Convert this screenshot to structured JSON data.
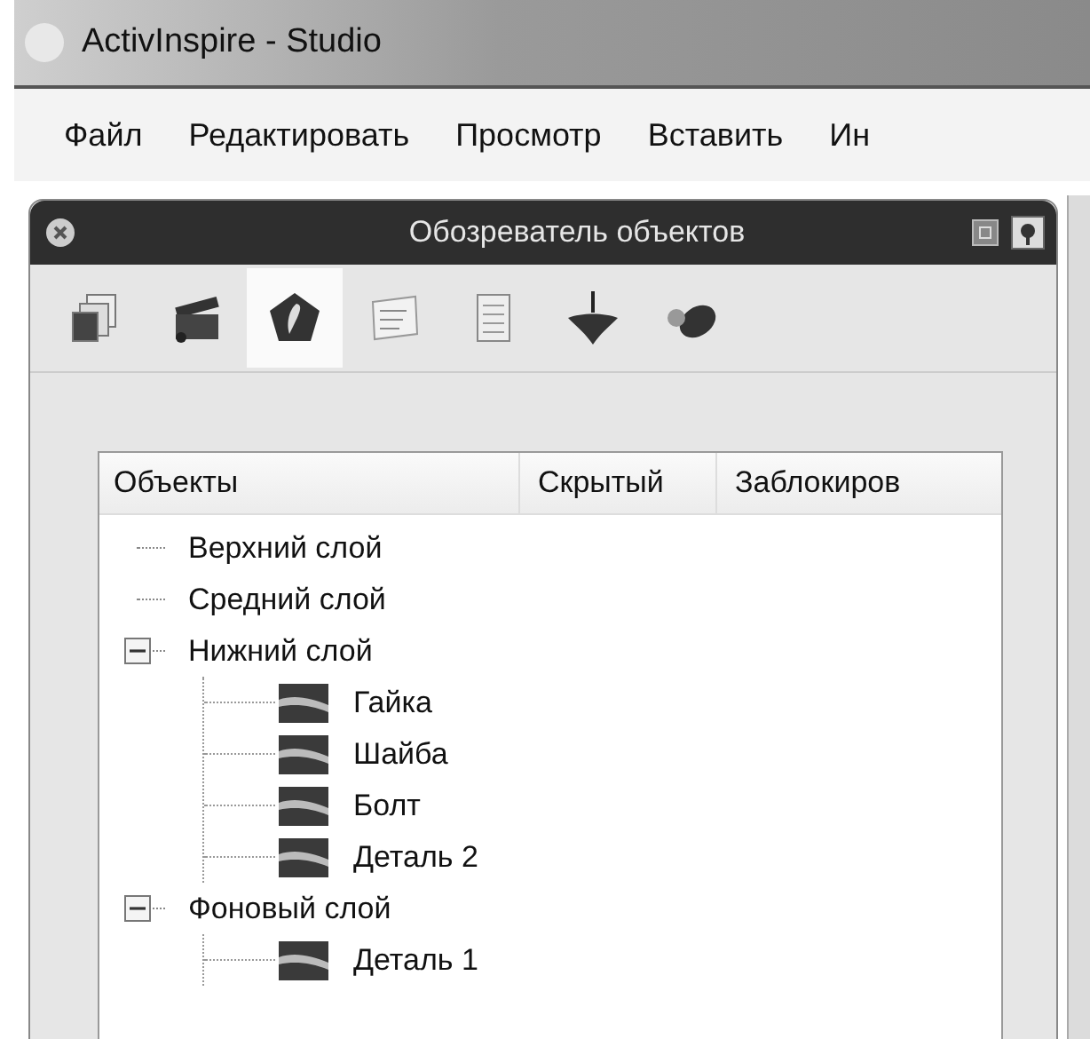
{
  "window": {
    "title": "ActivInspire - Studio"
  },
  "menu": [
    "Файл",
    "Редактировать",
    "Просмотр",
    "Вставить",
    "Ин"
  ],
  "panel": {
    "title": "Обозреватель объектов",
    "tabs": [
      {
        "selected": false
      },
      {
        "selected": false
      },
      {
        "selected": true
      },
      {
        "selected": false
      },
      {
        "selected": false
      },
      {
        "selected": false
      },
      {
        "selected": false
      }
    ],
    "columns": [
      "Объекты",
      "Скрытый",
      "Заблокиров"
    ],
    "tree": [
      {
        "label": "Верхний слой"
      },
      {
        "label": "Средний слой"
      },
      {
        "label": "Нижний слой",
        "expanded": true,
        "children": [
          {
            "label": "Гайка",
            "kind": "object"
          },
          {
            "label": "Шайба",
            "kind": "object"
          },
          {
            "label": "Болт",
            "kind": "object"
          },
          {
            "label": "Деталь 2",
            "kind": "object"
          }
        ]
      },
      {
        "label": "Фоновый слой",
        "expanded": true,
        "children": [
          {
            "label": "Деталь 1",
            "kind": "object"
          }
        ]
      }
    ]
  }
}
